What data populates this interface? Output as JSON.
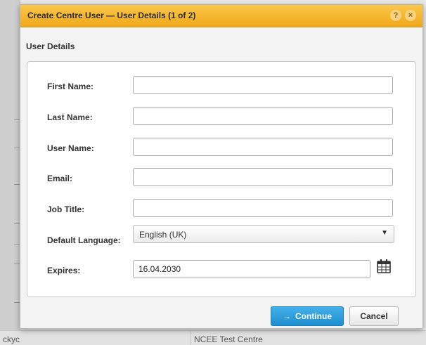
{
  "dialog": {
    "title": "Create Centre User — User Details (1 of 2)",
    "help_glyph": "?",
    "close_glyph": "×"
  },
  "section": {
    "header": "User Details"
  },
  "fields": [
    {
      "label": "First Name:",
      "value": ""
    },
    {
      "label": "Last Name:",
      "value": ""
    },
    {
      "label": "User Name:",
      "value": ""
    },
    {
      "label": "Email:",
      "value": ""
    },
    {
      "label": "Job Title:",
      "value": ""
    }
  ],
  "language": {
    "label": "Default Language:",
    "selected": "English (UK)",
    "arrow": "▼"
  },
  "expires": {
    "label": "Expires:",
    "value": "16.04.2030"
  },
  "buttons": {
    "continue_arrow": "→",
    "continue": "Continue",
    "cancel": "Cancel"
  },
  "background": {
    "row_col1": "ckyc",
    "row_col2": "NCEE Test Centre"
  },
  "colors": {
    "title_bar": "#f0a81a",
    "continue_button": "#2196d6",
    "panel": "#ffffff"
  },
  "icons": [
    "help-icon",
    "close-icon",
    "dropdown-arrow-icon",
    "calendar-icon",
    "arrow-right-icon"
  ]
}
